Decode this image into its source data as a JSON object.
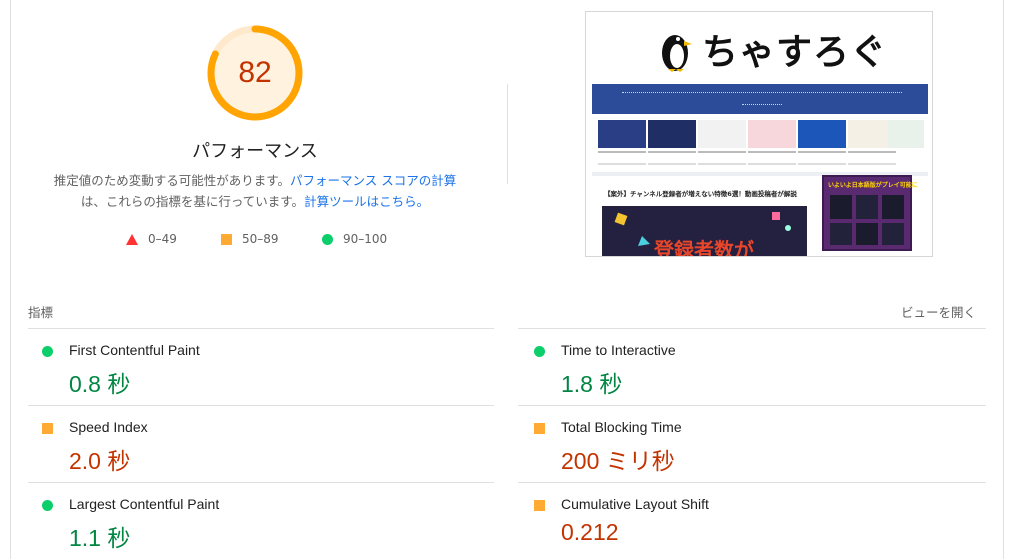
{
  "summary": {
    "score": "82",
    "score_fraction": 0.82,
    "title": "パフォーマンス",
    "desc_text1": "推定値のため変動する可能性があります。",
    "desc_link1": "パフォーマンス スコアの計算",
    "desc_text2": "は、これらの指標を基に行っています。",
    "desc_link2": "計算ツールはこちら。",
    "colors": {
      "fail": "#ff3333",
      "average": "#ffaa33",
      "pass": "#0cce6b",
      "link": "#1a73e8"
    }
  },
  "legend": [
    {
      "icon": "red-triangle-icon",
      "label": "0–49"
    },
    {
      "icon": "orange-square-icon",
      "label": "50–89"
    },
    {
      "icon": "green-circle-icon",
      "label": "90–100"
    }
  ],
  "screenshot": {
    "site_logo": "ちゃすろぐ",
    "article_title": "【案外】チャンネル登録者が増えない特徴6選！動画投稿者が解説",
    "article_image_text": "登録者数が",
    "ad_text": "いよいよ日本語版がプレイ可能に"
  },
  "metrics": {
    "label": "指標",
    "expand_label": "ビューを開く",
    "items": [
      {
        "name": "First Contentful Paint",
        "value": "0.8 秒",
        "status": "pass"
      },
      {
        "name": "Time to Interactive",
        "value": "1.8 秒",
        "status": "pass"
      },
      {
        "name": "Speed Index",
        "value": "2.0 秒",
        "status": "average"
      },
      {
        "name": "Total Blocking Time",
        "value": "200 ミリ秒",
        "status": "average"
      },
      {
        "name": "Largest Contentful Paint",
        "value": "1.1 秒",
        "status": "pass"
      },
      {
        "name": "Cumulative Layout Shift",
        "value": "0.212",
        "status": "average"
      }
    ]
  }
}
